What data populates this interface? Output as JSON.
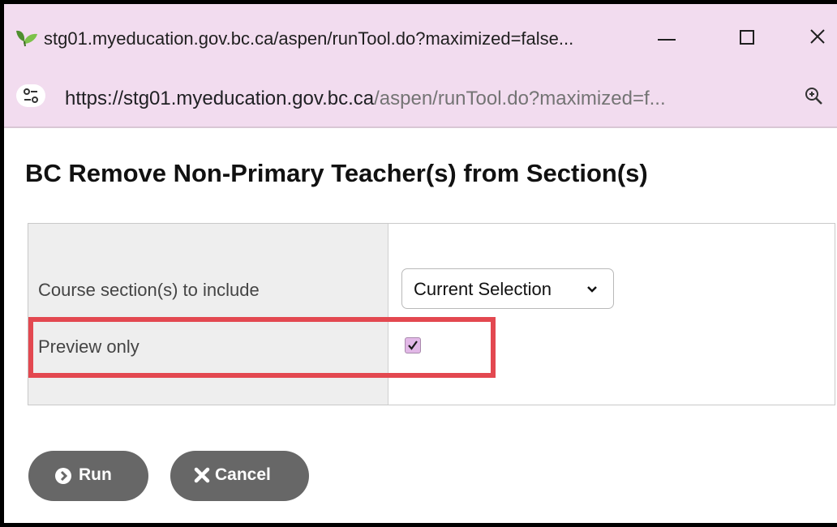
{
  "window": {
    "title": "stg01.myeducation.gov.bc.ca/aspen/runTool.do?maximized=false...",
    "url_host": "https://stg01.myeducation.gov.bc.ca",
    "url_rest": "/aspen/runTool.do?maximized=f..."
  },
  "page": {
    "title": "BC Remove Non-Primary Teacher(s) from Section(s)"
  },
  "form": {
    "course_label": "Course section(s) to include",
    "course_value": "Current Selection",
    "preview_label": "Preview only",
    "preview_checked": true
  },
  "buttons": {
    "run_label": "Run",
    "cancel_label": "Cancel"
  },
  "icons": {
    "app": "leaf-icon",
    "site_info": "tune-icon",
    "zoom": "zoom-in-icon",
    "run": "chevron-right-circle-icon",
    "cancel": "x-icon"
  },
  "colors": {
    "titlebar": "#f2dcef",
    "highlight": "#e34850",
    "button": "#676767",
    "checkbox": "#e2b8e7"
  }
}
